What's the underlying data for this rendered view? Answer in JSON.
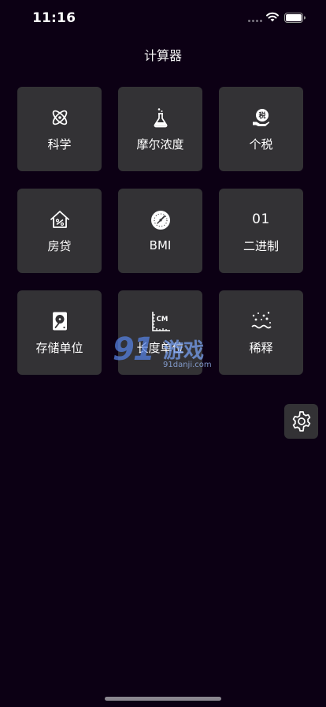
{
  "status_bar": {
    "time": "11:16"
  },
  "header": {
    "title": "计算器"
  },
  "tiles": [
    {
      "label": "科学",
      "icon": "atom-icon"
    },
    {
      "label": "摩尔浓度",
      "icon": "flask-icon"
    },
    {
      "label": "个税",
      "icon": "tax-hand-icon",
      "icon_text": "税"
    },
    {
      "label": "房贷",
      "icon": "house-percent-icon"
    },
    {
      "label": "BMI",
      "icon": "scale-dial-icon"
    },
    {
      "label": "二进制",
      "icon": "binary-icon",
      "icon_text": "01"
    },
    {
      "label": "存储单位",
      "icon": "hard-drive-icon"
    },
    {
      "label": "长度单位",
      "icon": "ruler-cm-icon",
      "icon_text": "CM"
    },
    {
      "label": "稀释",
      "icon": "dilution-dots-icon"
    }
  ],
  "settings": {
    "icon": "gear-icon"
  },
  "watermark": {
    "brand": "91",
    "name": "游戏",
    "url": "91danji.com"
  },
  "colors": {
    "background": "#0c0014",
    "tile": "#333235",
    "text": "#ffffff"
  }
}
